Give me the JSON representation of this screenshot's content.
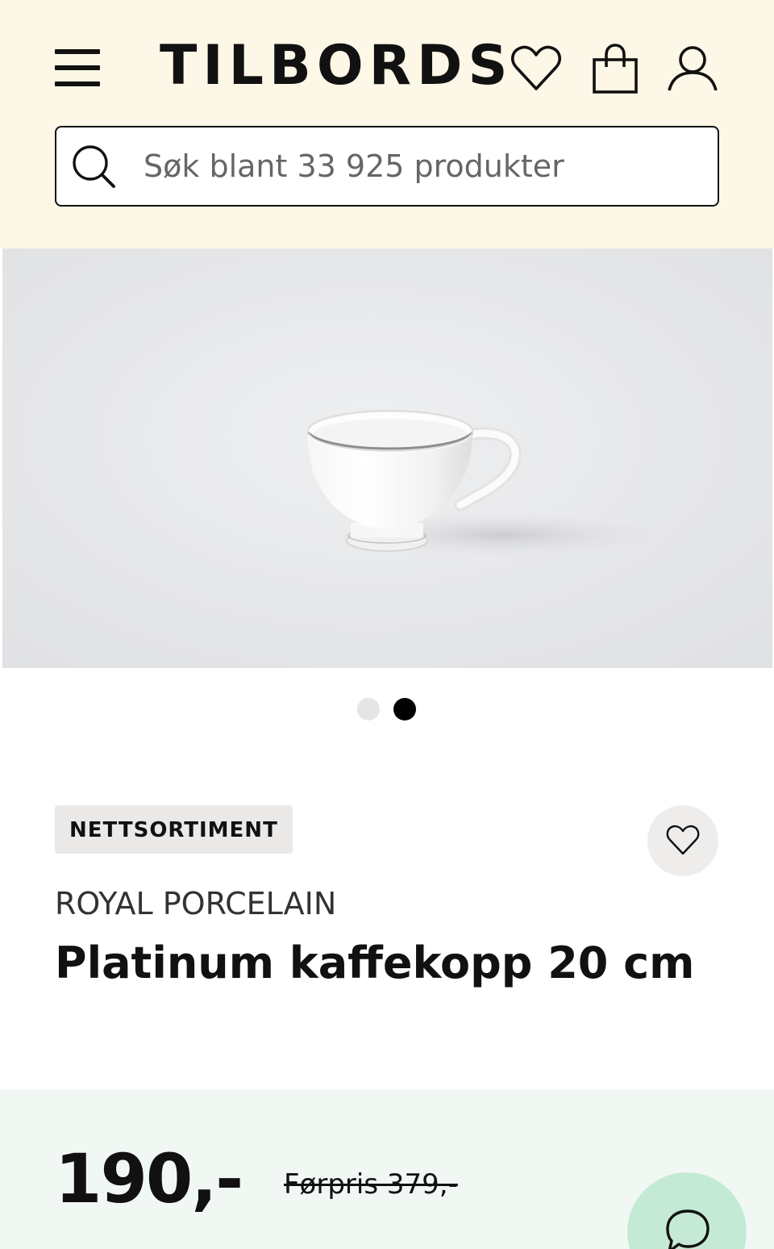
{
  "header": {
    "logo": "TILBORDS",
    "menu_icon": "menu-icon",
    "wishlist_icon": "heart-icon",
    "cart_icon": "shopping-bag-icon",
    "account_icon": "user-icon",
    "background": "#fcf7e6"
  },
  "search": {
    "placeholder": "Søk blant 33 925 produkter",
    "value": "",
    "icon": "search-icon"
  },
  "gallery": {
    "image_subject": "white porcelain coffee cup with platinum rim",
    "slide_count": 2,
    "active_slide": 2
  },
  "product": {
    "badge": "NETTSORTIMENT",
    "brand": "ROYAL PORCELAIN",
    "title": "Platinum kaffekopp 20 cm",
    "favorite_icon": "heart-icon"
  },
  "pricing": {
    "price": "190,-",
    "previous_price": "Førpris 379,-",
    "band_color": "#f1f8f4"
  },
  "chat": {
    "icon": "chat-bubble-icon",
    "color": "#c4ead5"
  }
}
